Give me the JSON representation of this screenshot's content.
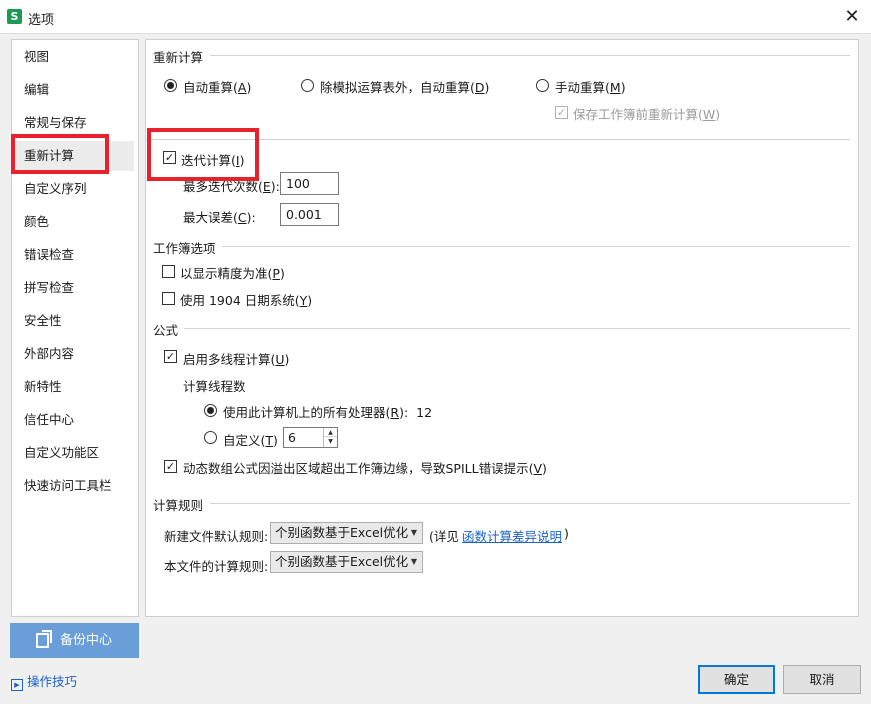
{
  "window": {
    "title": "选项",
    "app_icon_letter": "S",
    "close_glyph": "✕"
  },
  "sidebar": {
    "items": [
      {
        "label": "视图"
      },
      {
        "label": "编辑"
      },
      {
        "label": "常规与保存"
      },
      {
        "label": "重新计算"
      },
      {
        "label": "自定义序列"
      },
      {
        "label": "颜色"
      },
      {
        "label": "错误检查"
      },
      {
        "label": "拼写检查"
      },
      {
        "label": "安全性"
      },
      {
        "label": "外部内容"
      },
      {
        "label": "新特性"
      },
      {
        "label": "信任中心"
      },
      {
        "label": "自定义功能区"
      },
      {
        "label": "快速访问工具栏"
      }
    ],
    "selected": "重新计算"
  },
  "recalc": {
    "title": "重新计算",
    "auto": {
      "label": "自动重算(",
      "key": "A",
      "close": ")",
      "checked": true
    },
    "auto_except": {
      "label": "除模拟运算表外，自动重算(",
      "key": "D",
      "close": ")",
      "checked": false
    },
    "manual": {
      "label": "手动重算(",
      "key": "M",
      "close": ")",
      "checked": false
    },
    "save_recalc": {
      "label": "保存工作簿前重新计算(",
      "key": "W",
      "close": ")",
      "checked": true,
      "disabled": true
    },
    "iterative": {
      "label": "迭代计算(",
      "key": "I",
      "close": ")",
      "checked": true
    },
    "max_iter": {
      "label": "最多迭代次数(",
      "key": "E",
      "close": "):",
      "value": "100"
    },
    "max_change": {
      "label": "最大误差(",
      "key": "C",
      "close": "):",
      "value": "0.001"
    }
  },
  "workbook": {
    "title": "工作簿选项",
    "precision": {
      "label": "以显示精度为准(",
      "key": "P",
      "close": ")",
      "checked": false
    },
    "date1904": {
      "label": "使用 1904 日期系统(",
      "key": "Y",
      "close": ")",
      "checked": false
    }
  },
  "formula": {
    "title": "公式",
    "multithread": {
      "label": "启用多线程计算(",
      "key": "U",
      "close": ")",
      "checked": true
    },
    "threads_label": "计算线程数",
    "all_processors": {
      "label": "使用此计算机上的所有处理器(",
      "key": "R",
      "close": "):",
      "value": "12",
      "checked": true
    },
    "custom": {
      "label": "自定义(",
      "key": "T",
      "close": ")",
      "value": "6",
      "checked": false
    },
    "spill": {
      "label": "动态数组公式因溢出区域超出工作簿边缘，导致SPILL错误提示(",
      "key": "V",
      "close": ")",
      "checked": true
    }
  },
  "rules": {
    "title": "计算规则",
    "new_file_label": "新建文件默认规则:",
    "new_file_value": "个别函数基于Excel优化",
    "detail_prefix": "(详见",
    "detail_link": "函数计算差异说明",
    "detail_suffix": ")",
    "this_file_label": "本文件的计算规则:",
    "this_file_value": "个别函数基于Excel优化"
  },
  "footer": {
    "backup_label": "备份中心",
    "tips_label": "操作技巧",
    "ok_label": "确定",
    "cancel_label": "取消"
  },
  "colors": {
    "highlight_box": "#e8222a",
    "backup_button": "#6a9ed8",
    "link": "#1a63c9"
  }
}
